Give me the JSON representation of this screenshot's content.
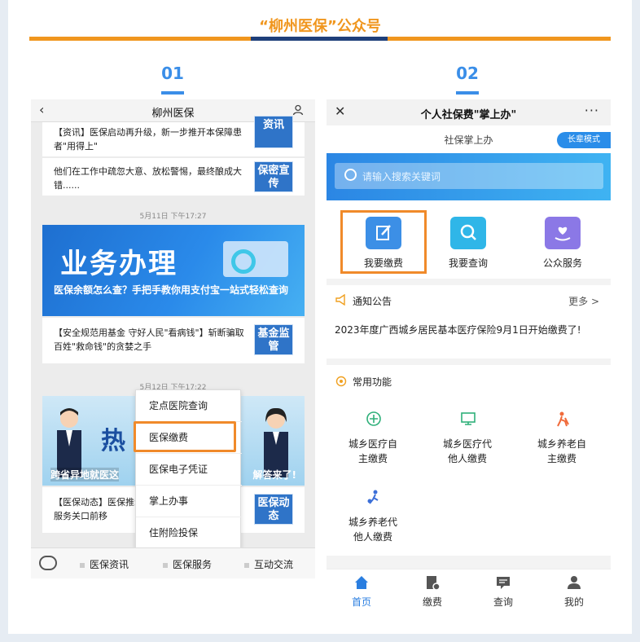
{
  "page_title": "“柳州医保”公众号",
  "colors": {
    "accent": "#f0961e",
    "navy": "#1f3f7a",
    "blue": "#3a8ee8",
    "highlight": "#f08a2a"
  },
  "steps": [
    {
      "number": "01"
    },
    {
      "number": "02"
    }
  ],
  "phone1": {
    "header": {
      "title": "柳州医保",
      "back_icon": "back-arrow-icon",
      "user_icon": "user-icon"
    },
    "messages": [
      {
        "text": "【资讯】医保启动再升级，新一步推开本保障患者\"用得上\"",
        "thumb": "资讯"
      },
      {
        "text": "他们在工作中疏忽大意、放松警惕，最终酿成大错......",
        "thumb": "保密宣传"
      },
      {
        "text": "【安全规范用基金 守好人民\"看病钱\"】斩断骗取百姓\"救命钱\"的贪婪之手",
        "thumb": "基金监管"
      },
      {
        "text": "【医保动态】医保推动服务关口前移",
        "thumb": "医保动态"
      }
    ],
    "timestamps": [
      "5月11日 下午17:27",
      "5月12日 下午17:22"
    ],
    "banner1": {
      "big_text": "业务办理",
      "caption": "医保余额怎么查？手把手教你用支付宝一站式轻松查询"
    },
    "banner2": {
      "big_text": "热",
      "caption_left": "跨省异地就医这",
      "caption_right": "解答来了!"
    },
    "popup_menu": [
      "定点医院查询",
      "医保缴费",
      "医保电子凭证",
      "掌上办事",
      "住附险投保"
    ],
    "highlighted_menu": "医保缴费",
    "tabbar": [
      "医保资讯",
      "医保服务",
      "互动交流"
    ]
  },
  "phone2": {
    "header": {
      "title": "个人社保费\"掌上办\"",
      "close_icon": "close-icon",
      "more": "···"
    },
    "subtitle": "社保掌上办",
    "elder_mode": "长辈模式",
    "search_placeholder": "请输入搜索关键词",
    "services": [
      {
        "label": "我要缴费",
        "icon": "edit-icon",
        "color": "#3c8fe6"
      },
      {
        "label": "我要查询",
        "icon": "search-icon",
        "color": "#2fb6e8"
      },
      {
        "label": "公众服务",
        "icon": "heart-hand-icon",
        "color": "#8b78e6"
      }
    ],
    "notice": {
      "label": "通知公告",
      "more": "更多 >",
      "text": "2023年度广西城乡居民基本医疗保险9月1日开始缴费了!"
    },
    "functions_label": "常用功能",
    "functions": [
      {
        "line1": "城乡医疗自",
        "line2": "主缴费"
      },
      {
        "line1": "城乡医疗代",
        "line2": "他人缴费"
      },
      {
        "line1": "城乡养老自",
        "line2": "主缴费"
      },
      {
        "line1": "城乡养老代",
        "line2": "他人缴费"
      }
    ],
    "tabbar": [
      "首页",
      "缴费",
      "查询",
      "我的"
    ]
  }
}
